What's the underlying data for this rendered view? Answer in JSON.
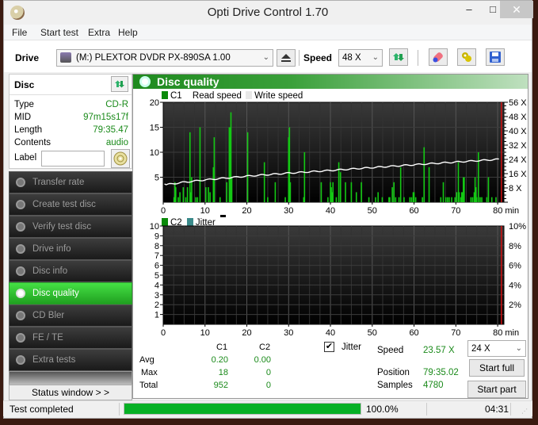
{
  "window": {
    "title": "Opti Drive Control 1.70",
    "controls": {
      "minimize": "–",
      "maximize": "□",
      "close": "✕"
    }
  },
  "menu": [
    "File",
    "Start test",
    "Extra",
    "Help"
  ],
  "toolbar": {
    "drive_label": "Drive",
    "drive_value": "(M:)  PLEXTOR DVDR  PX-890SA 1.00",
    "speed_label": "Speed",
    "speed_value": "48 X",
    "icons": [
      "drive-icon",
      "eject-icon",
      "refresh-icon",
      "erase-icon",
      "settings-icon",
      "save-icon"
    ]
  },
  "disc": {
    "title": "Disc",
    "fields": [
      {
        "key": "Type",
        "value": "CD-R"
      },
      {
        "key": "MID",
        "value": "97m15s17f"
      },
      {
        "key": "Length",
        "value": "79:35.47"
      },
      {
        "key": "Contents",
        "value": "audio"
      }
    ],
    "label_key": "Label",
    "label_value": ""
  },
  "nav": [
    {
      "label": "Transfer rate",
      "active": false
    },
    {
      "label": "Create test disc",
      "active": false
    },
    {
      "label": "Verify test disc",
      "active": false
    },
    {
      "label": "Drive info",
      "active": false
    },
    {
      "label": "Disc info",
      "active": false
    },
    {
      "label": "Disc quality",
      "active": true
    },
    {
      "label": "CD Bler",
      "active": false
    },
    {
      "label": "FE / TE",
      "active": false
    },
    {
      "label": "Extra tests",
      "active": false
    }
  ],
  "status_window_button": "Status window > >",
  "panel": {
    "title": "Disc quality"
  },
  "colors": {
    "accent_green": "#22b022",
    "c1_bar": "#14c814",
    "read_speed": "#ffffff",
    "end_marker": "#d01010",
    "value_green": "#1a8a1a",
    "progress_fill": "#06b025"
  },
  "chart_data": [
    {
      "type": "bar",
      "title": "C1 / Read speed",
      "legend": [
        "C1",
        "Read speed",
        "Write speed"
      ],
      "legend_placement": "top-left",
      "xlabel": "min",
      "x_ticks": [
        "0",
        "10",
        "20",
        "30",
        "40",
        "50",
        "60",
        "70",
        "80 min"
      ],
      "y_ticks_left": [
        "5",
        "10",
        "15",
        "20"
      ],
      "y_ticks_right": [
        "8 X",
        "16 X",
        "24 X",
        "32 X",
        "40 X",
        "48 X",
        "56 X"
      ],
      "xlim": [
        0,
        81.5
      ],
      "ylim": [
        0,
        20
      ],
      "y2lim": [
        0,
        56
      ],
      "grid": true,
      "end_marker_min": 80.9,
      "c1_bars": [
        [
          2.6,
          1
        ],
        [
          2.8,
          4
        ],
        [
          3.0,
          3
        ],
        [
          3.6,
          1
        ],
        [
          4.0,
          2
        ],
        [
          4.8,
          3
        ],
        [
          5.4,
          1
        ],
        [
          5.8,
          3
        ],
        [
          6.4,
          14
        ],
        [
          6.6,
          2
        ],
        [
          6.8,
          5
        ],
        [
          7.8,
          1
        ],
        [
          8.2,
          1
        ],
        [
          8.8,
          15
        ],
        [
          10.2,
          3
        ],
        [
          10.8,
          3
        ],
        [
          11.2,
          2
        ],
        [
          12.0,
          7
        ],
        [
          12.2,
          13
        ],
        [
          13.6,
          1
        ],
        [
          15.2,
          4
        ],
        [
          15.8,
          15
        ],
        [
          16.0,
          15
        ],
        [
          16.2,
          18
        ],
        [
          16.4,
          5
        ],
        [
          20.2,
          14
        ],
        [
          24.2,
          8
        ],
        [
          25.0,
          1
        ],
        [
          26.8,
          4
        ],
        [
          29.2,
          1
        ],
        [
          30.0,
          13
        ],
        [
          30.2,
          15
        ],
        [
          30.4,
          4
        ],
        [
          33.6,
          1
        ],
        [
          33.8,
          10
        ],
        [
          37.8,
          4
        ],
        [
          39.4,
          1
        ],
        [
          40.0,
          4
        ],
        [
          40.2,
          3
        ],
        [
          40.4,
          2
        ],
        [
          40.6,
          4
        ],
        [
          41.4,
          1
        ],
        [
          42.0,
          8
        ],
        [
          42.4,
          6
        ],
        [
          43.6,
          4
        ],
        [
          45.0,
          4
        ],
        [
          46.2,
          2
        ],
        [
          47.4,
          4
        ],
        [
          49.2,
          1
        ],
        [
          50.8,
          1
        ],
        [
          51.4,
          2
        ],
        [
          52.4,
          1
        ],
        [
          54.0,
          1
        ],
        [
          54.2,
          1
        ],
        [
          54.8,
          3
        ],
        [
          55.2,
          4
        ],
        [
          55.6,
          1
        ],
        [
          56.4,
          1
        ],
        [
          56.8,
          7
        ],
        [
          57.6,
          1
        ],
        [
          59.0,
          1
        ],
        [
          59.4,
          1
        ],
        [
          59.8,
          2
        ],
        [
          60.0,
          2
        ],
        [
          60.4,
          1
        ],
        [
          62.0,
          1
        ],
        [
          62.4,
          11
        ],
        [
          63.6,
          7
        ],
        [
          66.4,
          1
        ],
        [
          67.0,
          4
        ],
        [
          67.6,
          1
        ],
        [
          68.0,
          1
        ],
        [
          68.4,
          1
        ],
        [
          69.0,
          1
        ],
        [
          69.8,
          1
        ],
        [
          70.2,
          2
        ],
        [
          70.6,
          8
        ],
        [
          70.8,
          2
        ],
        [
          71.2,
          1
        ],
        [
          71.4,
          2
        ],
        [
          71.6,
          2
        ],
        [
          71.8,
          5
        ],
        [
          72.0,
          5
        ],
        [
          73.6,
          1
        ],
        [
          74.0,
          1
        ],
        [
          74.4,
          2
        ],
        [
          74.6,
          5
        ],
        [
          74.8,
          3
        ],
        [
          75.0,
          1
        ],
        [
          75.4,
          10
        ],
        [
          75.8,
          1
        ],
        [
          76.2,
          1
        ],
        [
          77.4,
          1
        ],
        [
          77.8,
          5
        ],
        [
          78.6,
          1
        ],
        [
          79.6,
          1
        ]
      ],
      "read_speed_x": [
        0.3,
        0.6,
        5,
        10,
        20,
        30,
        40,
        50,
        60,
        70,
        80
      ],
      "read_speed_y": [
        10.5,
        9.8,
        11.2,
        12.5,
        14.6,
        16.3,
        17.8,
        19.4,
        21.0,
        22.5,
        24.0
      ]
    },
    {
      "type": "line",
      "title": "C2 / Jitter",
      "legend": [
        "C2",
        "Jitter"
      ],
      "legend_placement": "top-left",
      "xlabel": "min",
      "x_ticks": [
        "0",
        "10",
        "20",
        "30",
        "40",
        "50",
        "60",
        "70",
        "80 min"
      ],
      "y_ticks_left": [
        "1",
        "2",
        "3",
        "4",
        "5",
        "6",
        "7",
        "8",
        "9",
        "10"
      ],
      "y_ticks_right": [
        "2%",
        "4%",
        "6%",
        "8%",
        "10%"
      ],
      "xlim": [
        0,
        81.5
      ],
      "ylim": [
        0,
        10
      ],
      "y2lim": [
        0,
        10
      ],
      "grid": true,
      "end_marker_min": 80.9,
      "c2_values": [],
      "jitter_values": []
    }
  ],
  "stats": {
    "columns": [
      "C1",
      "C2"
    ],
    "rows": [
      {
        "label": "Avg",
        "c1": "0.20",
        "c2": "0.00"
      },
      {
        "label": "Max",
        "c1": "18",
        "c2": "0"
      },
      {
        "label": "Total",
        "c1": "952",
        "c2": "0"
      }
    ],
    "jitter_label": "Jitter",
    "jitter_checked": true
  },
  "run": {
    "speed_label": "Speed",
    "speed_value": "23.57 X",
    "position_label": "Position",
    "position_value": "79:35.02",
    "samples_label": "Samples",
    "samples_value": "4780",
    "speed_select": "24 X",
    "start_full": "Start full",
    "start_part": "Start part"
  },
  "statusbar": {
    "text": "Test completed",
    "progress_percent": 100.0,
    "progress_text": "100.0%",
    "time": "04:31"
  }
}
